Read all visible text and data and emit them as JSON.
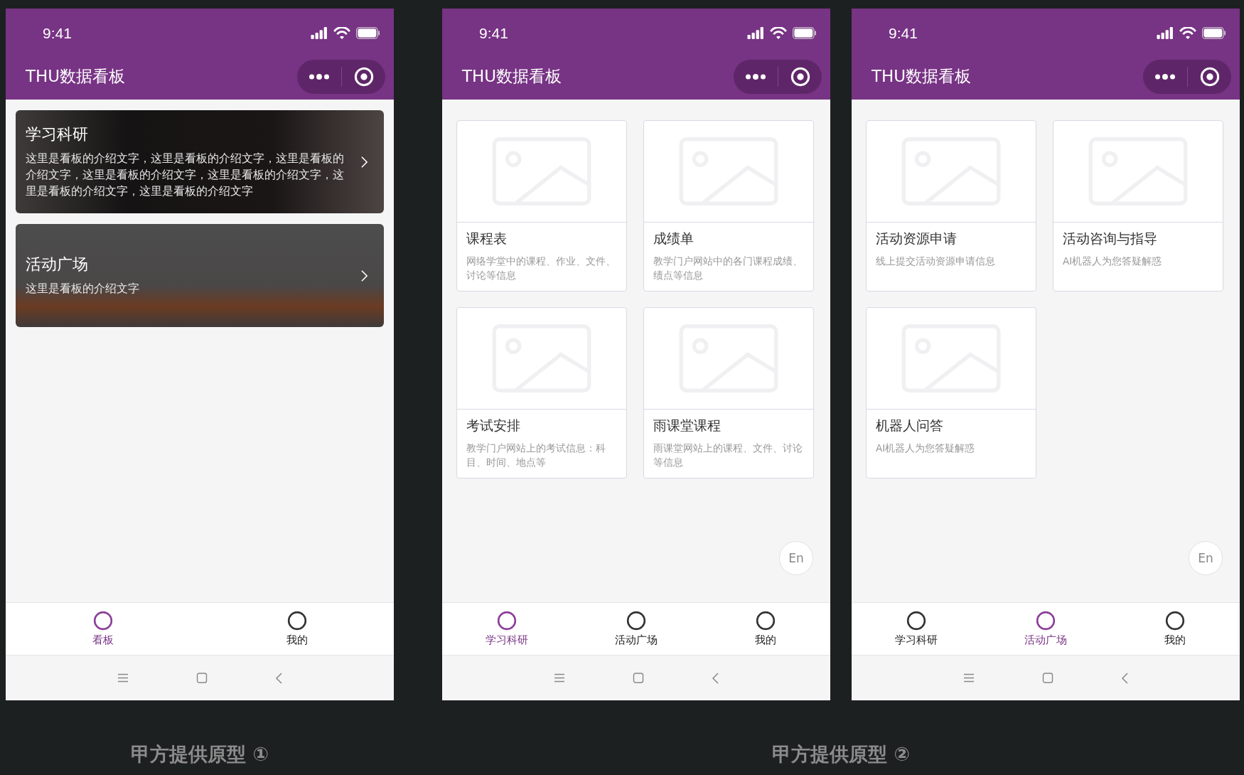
{
  "prototypes": [
    {
      "caption": "甲方提供原型 ①",
      "phones": [
        {
          "time": "9:41",
          "title": "THU数据看板",
          "kind": "banners",
          "banners": [
            {
              "title": "学习科研",
              "description": "这里是看板的介绍文字，这里是看板的介绍文字，这里是看板的介绍文字，这里是看板的介绍文字，这里是看板的介绍文字，这里是看板的介绍文字，这里是看板的介绍文字"
            },
            {
              "title": "活动广场",
              "description": "这里是看板的介绍文字"
            }
          ],
          "tabs": [
            {
              "label": "看板",
              "selected": true
            },
            {
              "label": "我的",
              "selected": false
            }
          ]
        }
      ]
    },
    {
      "caption": "甲方提供原型 ②",
      "phones": [
        {
          "time": "9:41",
          "title": "THU数据看板",
          "kind": "cards",
          "cards": [
            {
              "title": "课程表",
              "description": "网络学堂中的课程、作业、文件、讨论等信息"
            },
            {
              "title": "成绩单",
              "description": "教学门户网站中的各门课程成绩、绩点等信息"
            },
            {
              "title": "考试安排",
              "description": "教学门户网站上的考试信息：科目、时间、地点等"
            },
            {
              "title": "雨课堂课程",
              "description": "雨课堂网站上的课程、文件、讨论等信息"
            }
          ],
          "language_button": "En",
          "tabs": [
            {
              "label": "学习科研",
              "selected": true
            },
            {
              "label": "活动广场",
              "selected": false
            },
            {
              "label": "我的",
              "selected": false
            }
          ]
        },
        {
          "time": "9:41",
          "title": "THU数据看板",
          "kind": "cards",
          "cards": [
            {
              "title": "活动资源申请",
              "description": "线上提交活动资源申请信息"
            },
            {
              "title": "活动咨询与指导",
              "description": "AI机器人为您答疑解惑"
            },
            {
              "title": "机器人问答",
              "description": "AI机器人为您答疑解惑"
            }
          ],
          "language_button": "En",
          "tabs": [
            {
              "label": "学习科研",
              "selected": false
            },
            {
              "label": "活动广场",
              "selected": true
            },
            {
              "label": "我的",
              "selected": false
            }
          ]
        }
      ]
    }
  ]
}
